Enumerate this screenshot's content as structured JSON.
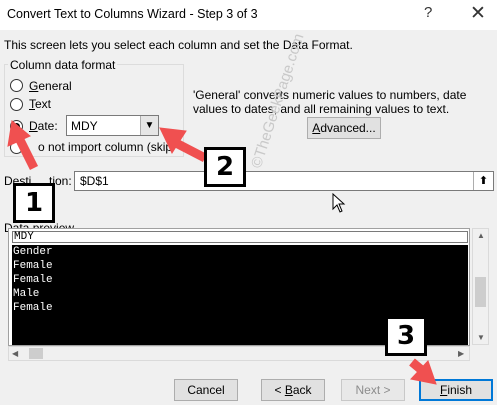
{
  "window": {
    "title": "Convert Text to Columns Wizard - Step 3 of 3",
    "help_glyph": "?",
    "close_glyph": "✕"
  },
  "intro_text": "This screen lets you select each column and set the Data Format.",
  "column_format": {
    "legend": "Column data format",
    "options": [
      {
        "label": "General",
        "accel": "G",
        "rest": "eneral",
        "checked": false
      },
      {
        "label": "Text",
        "accel": "T",
        "rest": "ext",
        "checked": false
      },
      {
        "label": "Date:",
        "accel": "D",
        "rest": "ate:",
        "checked": true
      },
      {
        "label": "Do not import column (skip)",
        "visible_text": "o not import column (skip",
        "checked": false
      }
    ],
    "date_value": "MDY"
  },
  "info_text": "'General' converts numeric values to numbers, date values to dates, and all remaining values to text.",
  "advanced_button": {
    "accel": "A",
    "rest": "dvanced..."
  },
  "destination": {
    "label_visible_left": "Desti",
    "label_visible_right": "tion:",
    "value": "$D$1"
  },
  "watermark": "©TheGeekPage.com",
  "preview": {
    "label_left": "Data ",
    "label_accel": "p",
    "label_rest": "review",
    "header": "MDY",
    "rows": [
      "Gender",
      "Female",
      "Female",
      "Male",
      "Female"
    ]
  },
  "buttons": {
    "cancel": "Cancel",
    "back": {
      "prefix": "< ",
      "accel": "B",
      "rest": "ack"
    },
    "next": "Next >",
    "finish": {
      "accel": "F",
      "rest": "inish"
    }
  },
  "annotations": {
    "badge_1": "1",
    "badge_2": "2",
    "badge_3": "3",
    "arrow_color": "#f05050"
  },
  "colors": {
    "accent": "#0078d7",
    "preview_bg": "#000000"
  }
}
